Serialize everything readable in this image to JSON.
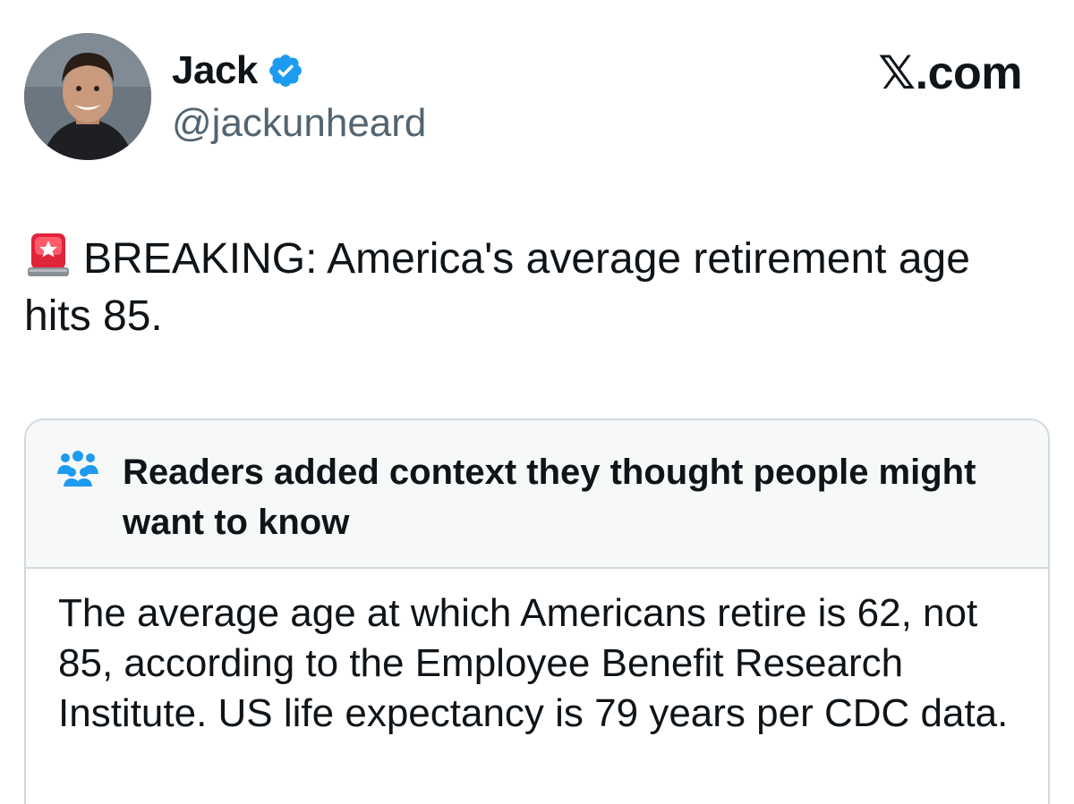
{
  "author": {
    "display_name": "Jack",
    "handle": "@jackunheard",
    "verified": true
  },
  "site": {
    "logo_text": "𝕏.com"
  },
  "tweet": {
    "icon": "rotating-light-icon",
    "text": "BREAKING: America's average retirement age hits 85."
  },
  "community_note": {
    "icon": "people-icon",
    "title": "Readers added context they thought people might want to know",
    "body": "The average age at which Americans retire is 62, not 85, according to the Employee Benefit Research Institute. US life expectancy is 79 years per CDC data."
  },
  "colors": {
    "verified_blue": "#1d9bf0",
    "note_icon_blue": "#1d9bf0",
    "handle_gray": "#536471",
    "border": "#cfd9de",
    "note_header_bg": "#f7f9f9",
    "siren_red": "#e0243a"
  }
}
